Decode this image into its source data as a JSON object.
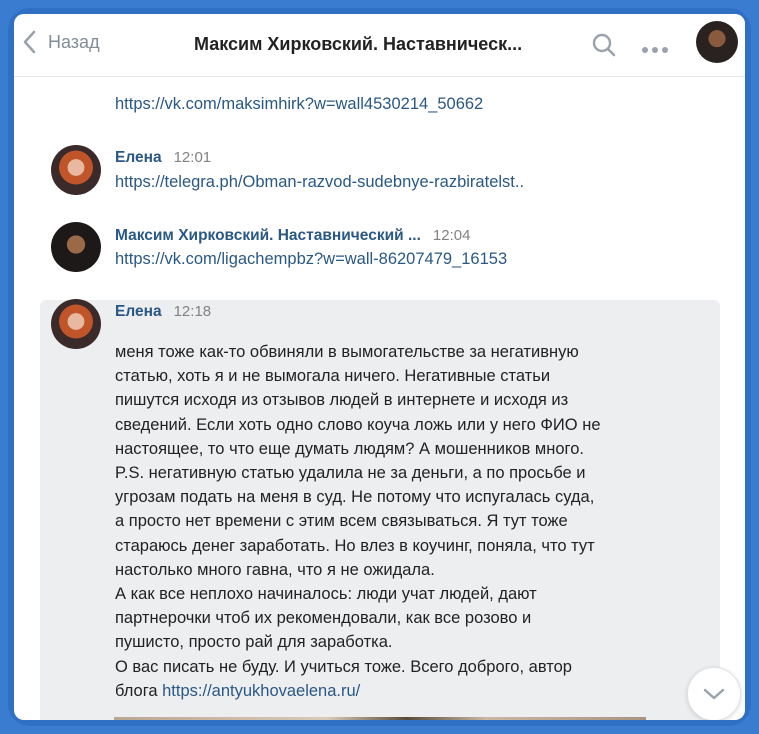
{
  "header": {
    "back_label": "Назад",
    "title": "Максим Хирковский. Наставническ..."
  },
  "messages": {
    "m0_link": "https://vk.com/maksimhirk?w=wall4530214_50662",
    "m1": {
      "name": "Елена",
      "time": "12:01",
      "link": "https://telegra.ph/Obman-razvod-sudebnye-razbiratelst.."
    },
    "m2": {
      "name": "Максим Хирковский. Наставнический ...",
      "time": "12:04",
      "link": "https://vk.com/ligachempbz?w=wall-86207479_16153"
    },
    "m3": {
      "name": "Елена",
      "time": "12:18",
      "lines": [
        "меня тоже как-то обвиняли в вымогательстве за негативную",
        "статью, хоть я и не вымогала ничего. Негативные статьи",
        "пишутся исходя из отзывов людей в интернете и исходя из",
        "сведений. Если хоть одно слово коуча ложь или у него ФИО не",
        "настоящее, то что еще думать людям? А мошенников много.",
        "P.S. негативную статью удалила не за деньги, а по просьбе и",
        "угрозам подать на меня в суд. Не потому что испугалась суда,",
        "а просто нет времени с этим всем связываться. Я тут тоже",
        "стараюсь денег заработать. Но влез в коучинг, поняла, что тут",
        "настолько много гавна, что я не ожидала.",
        "А как все неплохо начиналось: люди учат людей, дают",
        "партнерочки чтоб их рекомендовали, как все розово и",
        "пушисто, просто рай для заработка.",
        "О вас писать не буду. И учиться тоже. Всего доброго, автор"
      ],
      "last_prefix": "блога ",
      "last_link": "https://antyukhovaelena.ru/"
    }
  },
  "colors": {
    "accent": "#2a5885",
    "frame": "#2f6fc4",
    "highlight": "#edeef0"
  },
  "icons": [
    "chevron-left-icon",
    "search-icon",
    "more-icon",
    "chevron-down-icon"
  ]
}
